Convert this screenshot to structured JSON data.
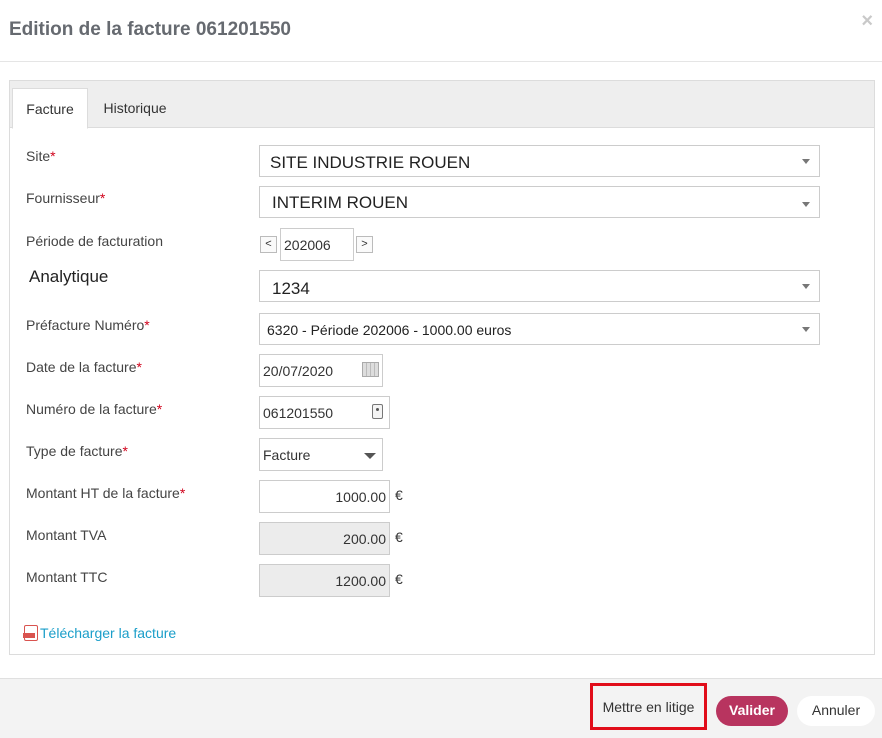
{
  "modal": {
    "title": "Edition de la facture 061201550",
    "close_glyph": "×"
  },
  "tabs": [
    {
      "label": "Facture",
      "active": true
    },
    {
      "label": "Historique",
      "active": false
    }
  ],
  "form": {
    "site": {
      "label": "Site",
      "required_mark": "*",
      "value": "SITE INDUSTRIE ROUEN"
    },
    "fournisseur": {
      "label": "Fournisseur",
      "required_mark": "*",
      "value": "INTERIM ROUEN"
    },
    "periode": {
      "label": "Période de facturation",
      "value": "202006",
      "prev_glyph": "<",
      "next_glyph": ">"
    },
    "analytique": {
      "label": "Analytique",
      "value": "1234"
    },
    "prefacture": {
      "label": "Préfacture Numéro",
      "required_mark": "*",
      "value": "6320 - Période 202006 - 1000.00 euros"
    },
    "date": {
      "label": "Date de la facture",
      "required_mark": "*",
      "value": "20/07/2020"
    },
    "numero": {
      "label": "Numéro de la facture",
      "required_mark": "*",
      "value": "061201550"
    },
    "type": {
      "label": "Type de facture",
      "required_mark": "*",
      "value": "Facture"
    },
    "montant_ht": {
      "label": "Montant HT de la facture",
      "required_mark": "*",
      "value": "1000.00",
      "currency": "€"
    },
    "montant_tva": {
      "label": "Montant TVA",
      "value": "200.00",
      "currency": "€"
    },
    "montant_ttc": {
      "label": "Montant TTC",
      "value": "1200.00",
      "currency": "€"
    }
  },
  "download": {
    "label": "Télécharger la facture",
    "icon": "pdf-icon"
  },
  "footer": {
    "litige_label": "Mettre en litige",
    "valider_label": "Valider",
    "annuler_label": "Annuler"
  },
  "colors": {
    "accent": "#b8345f",
    "link": "#1a9ec9",
    "required": "#d0021b",
    "highlight_border": "#e10d1a"
  }
}
